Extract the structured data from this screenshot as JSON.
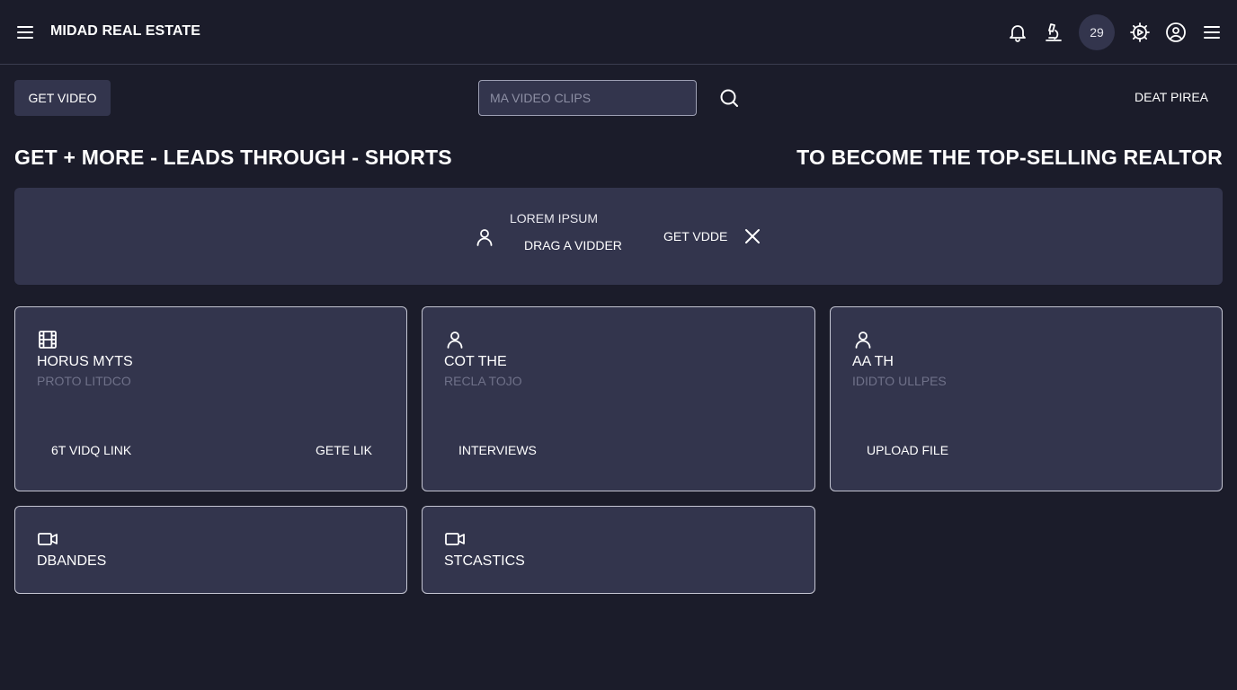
{
  "header": {
    "brand": "MIDAD REAL ESTATE",
    "notification_count": "29",
    "icons": [
      "menu-icon",
      "bell-icon",
      "microscope-icon",
      "gear-icon",
      "user-circle-icon",
      "menu-icon"
    ]
  },
  "toolbar": {
    "get_video_label": "GET VIDEO",
    "search_placeholder": "MA VIDEO CLIPS",
    "search_value": "",
    "right_link": "DEAT PIREA"
  },
  "headlines": {
    "left": "GET + MORE - LEADS THROUGH - SHORTS",
    "right": "TO BECOME THE TOP-SELLING REALTOR"
  },
  "banner": {
    "title": "LOREM IPSUM",
    "drag_label": "DRAG A VIDDER",
    "get_label": "GET VDDE"
  },
  "cards": [
    {
      "icon": "film-icon",
      "title": "HORUS MYTS",
      "subtitle": "PROTO LITDCO",
      "actions": [
        "6T VIDQ LINK",
        "GETE LIK"
      ]
    },
    {
      "icon": "user-icon",
      "title": "COT THE",
      "subtitle": "RECLA TOJO",
      "actions": [
        "INTERVIEWS"
      ]
    },
    {
      "icon": "user-icon",
      "title": "AA TH",
      "subtitle": "IDIDTO ULLPES",
      "actions": [
        "UPLOAD FILE"
      ]
    },
    {
      "icon": "video-camera-icon",
      "title": "DBANDES"
    },
    {
      "icon": "video-camera-icon",
      "title": "STCASTICS"
    }
  ],
  "colors": {
    "background": "#1b1c2a",
    "surface": "#33354d",
    "border": "#c4c5d2",
    "muted_text": "#6f7189"
  }
}
